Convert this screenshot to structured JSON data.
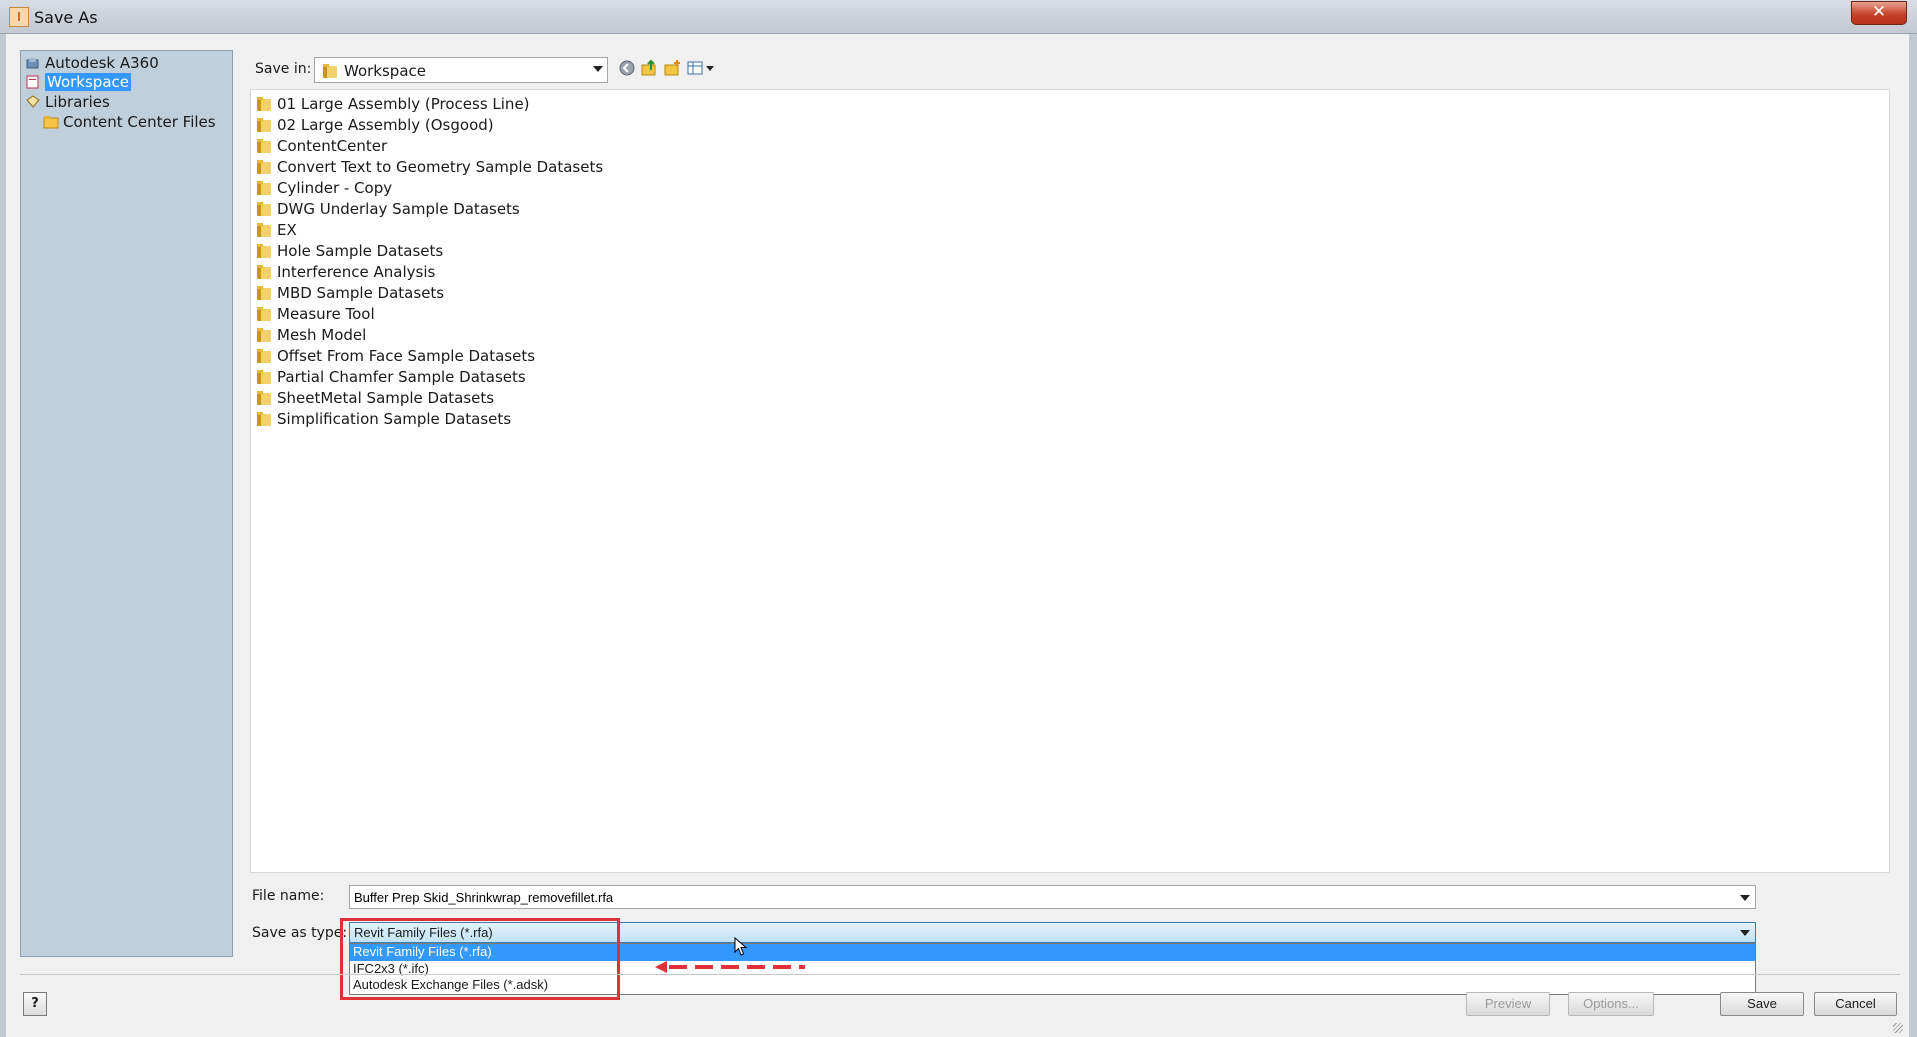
{
  "window": {
    "title": "Save As",
    "close_label": "✕"
  },
  "sidebar": {
    "items": [
      {
        "label": "Autodesk A360",
        "icon": "cloud-icon"
      },
      {
        "label": "Workspace",
        "icon": "workspace-icon",
        "selected": true
      },
      {
        "label": "Libraries",
        "icon": "library-icon"
      },
      {
        "label": "Content Center Files",
        "icon": "folder-icon"
      }
    ]
  },
  "toolbar": {
    "save_in_label": "Save in:",
    "save_in_value": "Workspace",
    "tools": [
      "back-icon",
      "up-folder-icon",
      "new-folder-icon",
      "view-menu-icon"
    ]
  },
  "folders": [
    "01 Large Assembly (Process Line)",
    "02 Large Assembly (Osgood)",
    "ContentCenter",
    "Convert Text to Geometry Sample Datasets",
    "Cylinder - Copy",
    "DWG Underlay Sample Datasets",
    "EX",
    "Hole Sample Datasets",
    "Interference Analysis",
    "MBD Sample Datasets",
    "Measure Tool",
    "Mesh Model",
    "Offset From Face Sample Datasets",
    "Partial Chamfer Sample Datasets",
    "SheetMetal Sample Datasets",
    "Simplification Sample Datasets"
  ],
  "form": {
    "file_name_label": "File name:",
    "file_name_value": "Buffer Prep Skid_Shrinkwrap_removefillet.rfa",
    "save_as_type_label": "Save as type:",
    "save_as_type_value": "Revit Family Files (*.rfa)",
    "type_options": [
      "Revit Family Files (*.rfa)",
      "IFC2x3 (*.ifc)",
      "Autodesk Exchange Files (*.adsk)"
    ]
  },
  "buttons": {
    "help": "?",
    "preview": "Preview",
    "options": "Options...",
    "save": "Save",
    "cancel": "Cancel"
  },
  "colors": {
    "selection": "#3399ff",
    "sidebar_bg": "#bfcfdc",
    "annotation_red": "#e03038"
  }
}
